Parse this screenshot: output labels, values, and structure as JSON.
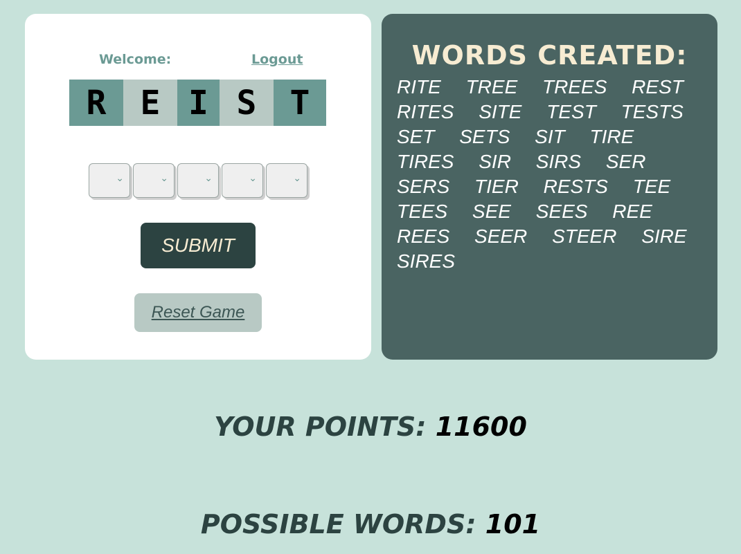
{
  "header": {
    "welcome_label": "Welcome:",
    "logout_label": "Logout"
  },
  "tiles": [
    "R",
    "E",
    "I",
    "S",
    "T"
  ],
  "selects": {
    "chevron": "⌄",
    "count": 5
  },
  "buttons": {
    "submit_label": "SUBMIT",
    "reset_label": "Reset Game"
  },
  "words_panel": {
    "title": "WORDS CREATED:",
    "words": [
      "RITE",
      "TREE",
      "TREES",
      "REST",
      "RITES",
      "SITE",
      "TEST",
      "TESTS",
      "SET",
      "SETS",
      "SIT",
      "TIRE",
      "TIRES",
      "SIR",
      "SIRS",
      "SER",
      "SERS",
      "TIER",
      "RESTS",
      "TEE",
      "TEES",
      "SEE",
      "SEES",
      "REE",
      "REES",
      "SEER",
      "STEER",
      "SIRE",
      "SIRES"
    ]
  },
  "stats": {
    "points_label": "YOUR POINTS:",
    "points_value": "11600",
    "possible_label": "POSSIBLE WORDS:",
    "possible_value": "101"
  },
  "colors": {
    "background": "#c7e2da",
    "panel_dark": "#4a6462",
    "tile_dark": "#6b9a94",
    "tile_light": "#b8c9c4",
    "submit_bg": "#2c4341",
    "cream": "#f7ecd2"
  }
}
